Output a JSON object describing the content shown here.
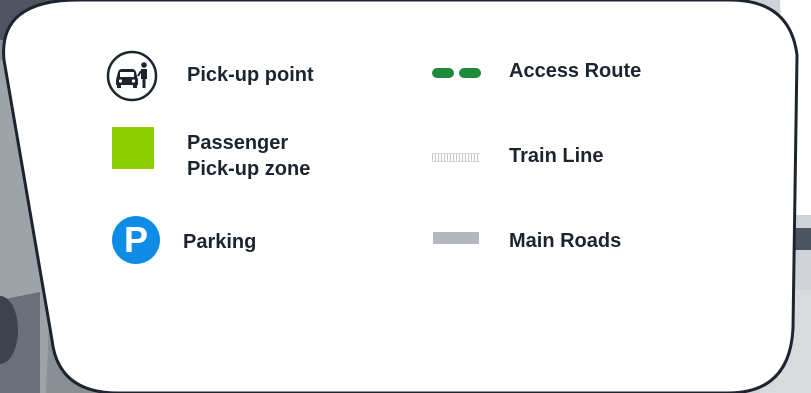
{
  "legend": {
    "items": {
      "pickup_point": {
        "label": "Pick-up point",
        "icon": "car-and-person-icon"
      },
      "passenger_zone": {
        "label_line1": "Passenger",
        "label_line2": "Pick-up zone",
        "icon": "green-square-icon"
      },
      "parking": {
        "label": "Parking",
        "icon": "parking-p-icon",
        "icon_text": "P"
      },
      "access_route": {
        "label": "Access Route",
        "icon": "dashed-route-icon"
      },
      "train_line": {
        "label": "Train Line",
        "icon": "train-track-icon"
      },
      "main_roads": {
        "label": "Main Roads",
        "icon": "road-bar-icon"
      }
    }
  },
  "colors": {
    "card_background": "#ffffff",
    "card_border": "#1d2430",
    "text": "#1d2430",
    "zone_green": "#8ccf00",
    "route_green": "#1d8a3c",
    "parking_blue": "#0f8de6",
    "road_gray": "#b4b8bd",
    "map_gray": "#5a6068"
  }
}
